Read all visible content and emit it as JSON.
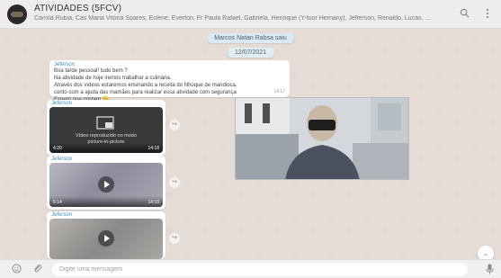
{
  "header": {
    "title": "ATIVIDADES (5FCV)",
    "members": "Camila Rubia, Cas Maria Vitória Soares, Eslene, Everton, Fr Paula Rafael, Gabriela, Henrique (Y-tuor Hernany), Jefferson, Renaldo, Lucas, ...",
    "avatar_icon": "group-avatar",
    "search_icon": "search-icon",
    "menu_icon": "more-vert-icon"
  },
  "chat": {
    "system_notice": "Marcos Natan Rabsa saiu",
    "date_chip": "12/07/2021",
    "text_message": {
      "sender": "Jeferson",
      "lines": [
        "Boa tarde pessoal! tudo bem ?",
        "Na atividade de hoje iremos trabalhar a culinária.",
        "Através dos vídeos estaremos ensinando a receita do Nhoque de mandioca.",
        "conto com a ajuda das mamães para realizar essa atividade com segurança",
        "Espero que gostem 😊"
      ],
      "time": "14:17"
    },
    "videos": [
      {
        "sender": "Jeferson",
        "overlay": "Vídeo reproduzido no modo picture-in-picture",
        "size": "4:20",
        "time": "14:18"
      },
      {
        "sender": "Jeferson",
        "size": "5:14",
        "time": "14:18"
      },
      {
        "sender": "Jeferson"
      }
    ],
    "share_icon": "share-icon",
    "scroll_icon": "chevron-down-icon"
  },
  "pip": {
    "label": "picture-in-picture video"
  },
  "footer": {
    "placeholder": "Digite uma mensagem",
    "emoji_icon": "emoji-icon",
    "attach_icon": "attach-icon",
    "mic_icon": "mic-icon"
  }
}
